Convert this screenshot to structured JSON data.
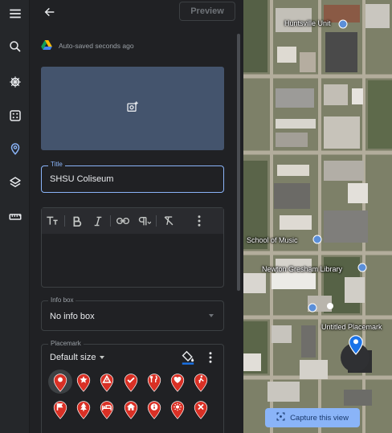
{
  "rail": {
    "items": [
      {
        "name": "menu-icon"
      },
      {
        "name": "search-icon"
      },
      {
        "name": "voyager-wheel-icon"
      },
      {
        "name": "dice-icon"
      },
      {
        "name": "projects-pin-icon"
      },
      {
        "name": "layers-icon"
      },
      {
        "name": "ruler-icon"
      }
    ]
  },
  "header": {
    "preview_label": "Preview"
  },
  "autosave": {
    "text": "Auto-saved seconds ago"
  },
  "title_field": {
    "label": "Title",
    "value": "SHSU Coliseum"
  },
  "info_box": {
    "label": "Info box",
    "value": "No info box"
  },
  "placemark": {
    "label": "Placemark",
    "size_value": "Default size",
    "pin_color": "#d93025",
    "icons": [
      "dot",
      "star",
      "triangle",
      "check",
      "restaurant",
      "heart",
      "walk",
      "flag",
      "tree",
      "bed",
      "home",
      "info",
      "sun",
      "close"
    ]
  },
  "map": {
    "labels": {
      "huntsville": "Huntsville Unit",
      "music": "School of Music",
      "library": "Newton Gresham Library",
      "untitled": "Untitled Placemark"
    },
    "capture_label": "Capture this view",
    "marker_color": "#1a73e8"
  }
}
